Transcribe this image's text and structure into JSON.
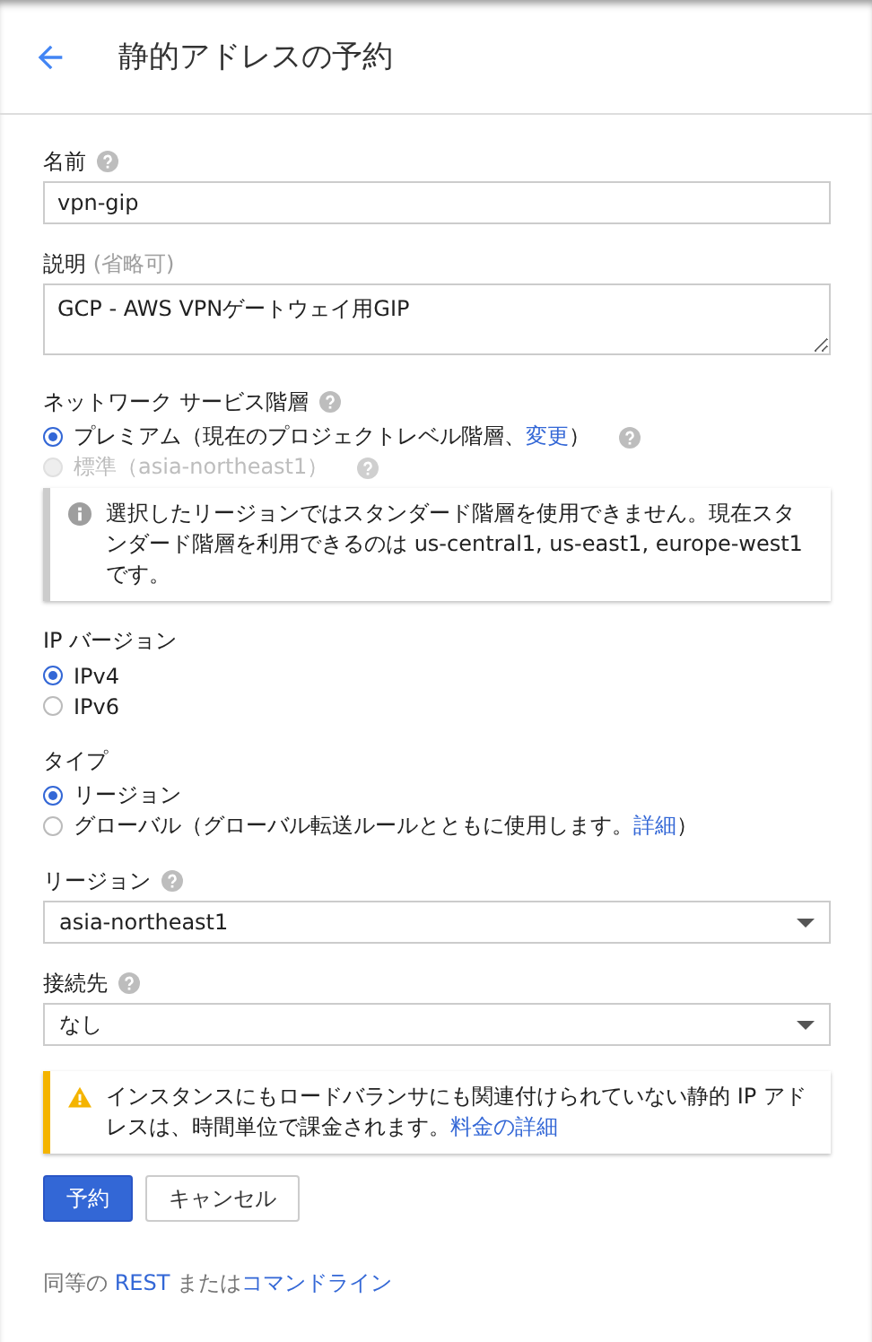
{
  "header": {
    "title": "静的アドレスの予約"
  },
  "name_field": {
    "label": "名前",
    "value": "vpn-gip"
  },
  "description_field": {
    "label": "説明",
    "hint": "(省略可)",
    "value": "GCP - AWS VPNゲートウェイ用GIP"
  },
  "network_tier": {
    "label": "ネットワーク サービス階層",
    "options": [
      {
        "parts": [
          {
            "text": "プレミアム（現在のプロジェクトレベル階層、",
            "link": false
          },
          {
            "text": "変更",
            "link": true
          },
          {
            "text": "）",
            "link": false
          }
        ],
        "selected": true,
        "disabled": false
      },
      {
        "parts": [
          {
            "text": "標準（asia-northeast1）",
            "link": false
          }
        ],
        "selected": false,
        "disabled": true
      }
    ],
    "notice": {
      "kind": "info",
      "parts": [
        {
          "text": "選択したリージョンではスタンダード階層を使用できません。現在スタンダード階層を利用できるのは us-central1, us-east1, europe-west1 です。",
          "link": false
        }
      ]
    }
  },
  "ip_version": {
    "label": "IP バージョン",
    "options": [
      {
        "parts": [
          {
            "text": "IPv4",
            "link": false
          }
        ],
        "selected": true,
        "disabled": false
      },
      {
        "parts": [
          {
            "text": "IPv6",
            "link": false
          }
        ],
        "selected": false,
        "disabled": false
      }
    ]
  },
  "type": {
    "label": "タイプ",
    "options": [
      {
        "parts": [
          {
            "text": "リージョン",
            "link": false
          }
        ],
        "selected": true,
        "disabled": false
      },
      {
        "parts": [
          {
            "text": "グローバル（グローバル転送ルールとともに使用します。",
            "link": false
          },
          {
            "text": "詳細",
            "link": true
          },
          {
            "text": "）",
            "link": false
          }
        ],
        "selected": false,
        "disabled": false
      }
    ]
  },
  "region": {
    "label": "リージョン",
    "value": "asia-northeast1"
  },
  "attached_to": {
    "label": "接続先",
    "value": "なし"
  },
  "warning": {
    "kind": "warning",
    "parts": [
      {
        "text": "インスタンスにもロードバランサにも関連付けられていない静的 IP アドレスは、時間単位で課金されます。",
        "link": false
      },
      {
        "text": "料金の詳細",
        "link": true
      }
    ]
  },
  "buttons": [
    {
      "label": "予約",
      "kind": "primary"
    },
    {
      "label": "キャンセル",
      "kind": "secondary"
    }
  ],
  "footer": {
    "parts": [
      {
        "text": "同等の ",
        "link": false
      },
      {
        "text": "REST",
        "link": true
      },
      {
        "text": " または",
        "link": false
      },
      {
        "text": "コマンドライン",
        "link": true
      }
    ]
  }
}
